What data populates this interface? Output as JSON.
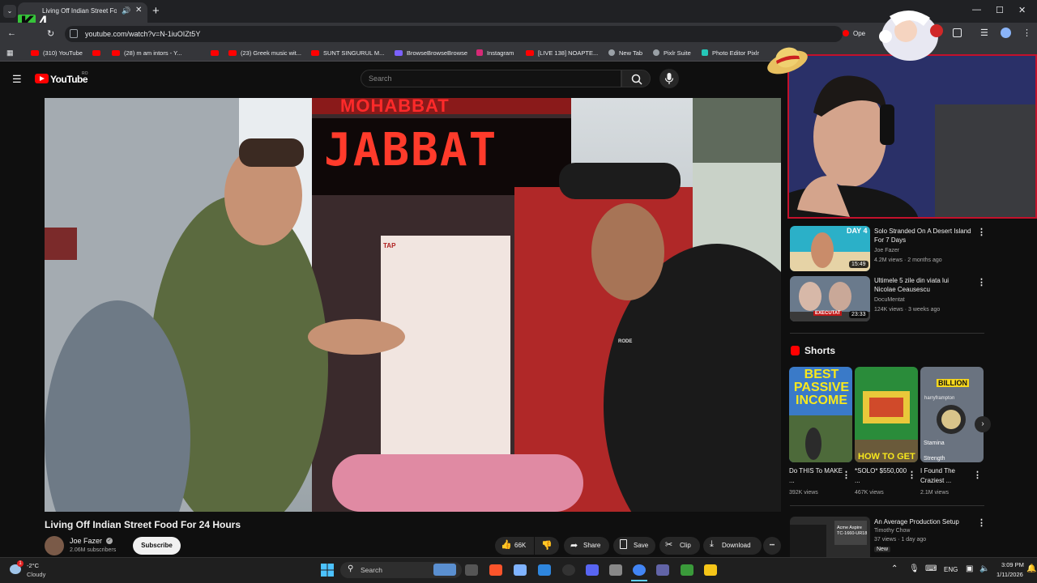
{
  "browser": {
    "tab_title": "Living Off Indian Street Foo...",
    "new_tab_symbol": "+",
    "url": "youtube.com/watch?v=N-1iuOIZt5Y",
    "stream_overlay_text": "4",
    "stream_overlay_logo": "K",
    "window_controls": [
      "—",
      "☐",
      "✕"
    ],
    "extension_label": "Ope",
    "bookmarks": [
      "(310) YouTube",
      "",
      "(28) m am intors - Y...",
      "(23) Greek music wit...",
      "SUNT SINGURUL M...",
      "BrowseBrowseBrowse",
      "Instagram",
      "[LIVE 138] NOAPTE...",
      "New Tab",
      "Pixlr Suite",
      "Photo Editor Pixlr"
    ]
  },
  "youtube": {
    "logo": "YouTube",
    "logo_country": "RO",
    "search_placeholder": "Search",
    "video": {
      "title": "Living Off Indian Street Food For 24 Hours",
      "scene_sign": "JABBAT",
      "scene_sign_top": "MOHABBAT",
      "shirt_text": "RODE",
      "tap_text": "TAP",
      "channel": "Joe Fazer",
      "verified": "✓",
      "subscribers": "2.06M subscribers",
      "subscribe_label": "Subscribe",
      "likes": "66K",
      "share_label": "Share",
      "save_label": "Save",
      "clip_label": "Clip",
      "download_label": "Download",
      "more_label": "•••"
    },
    "recommendations": [
      {
        "title": "Solo Stranded On A Desert Island For 7 Days",
        "channel": "Joe Fazer",
        "meta": "4.2M views · 2 months ago",
        "duration": "15:49",
        "thumb_text": "DAY 4"
      },
      {
        "title": "Ultimele 5 zile din viata lui Nicolae Ceausescu",
        "channel": "DocuMentat",
        "meta": "124K views · 3 weeks ago",
        "duration": "23:33",
        "thumb_text": "EXECUTAT"
      },
      {
        "title": "An Average Production Setup",
        "channel": "Timothy Chow",
        "meta": "37 views · 1 day ago",
        "duration": "7:27",
        "badge": "New",
        "thumb_text": "Acme Aspire TC-1660-UR18"
      }
    ],
    "shorts_heading": "Shorts",
    "shorts": [
      {
        "title": "Do THIS To MAKE ...",
        "views": "392K views",
        "thumb_text": "BEST PASSIVE INCOME"
      },
      {
        "title": "*SOLO* $550,000 ...",
        "views": "467K views",
        "thumb_text": "HOW TO GET"
      },
      {
        "title": "I Found The Craziest ...",
        "views": "2.1M views",
        "thumb_text": "BILLION",
        "thumb_sub": "Stamina",
        "thumb_sub2": "Strength",
        "thumb_name": "harryframpton"
      }
    ]
  },
  "taskbar": {
    "weather_temp": "-2°C",
    "weather_desc": "Cloudy",
    "weather_badge": "1",
    "search_label": "Search",
    "lang": "ENG",
    "time": "3:09 PM",
    "date": "1/11/2026"
  },
  "colors": {
    "accent_red": "#ff0000",
    "webcam_border": "#c4112b",
    "bg": "#0f0f0f"
  }
}
